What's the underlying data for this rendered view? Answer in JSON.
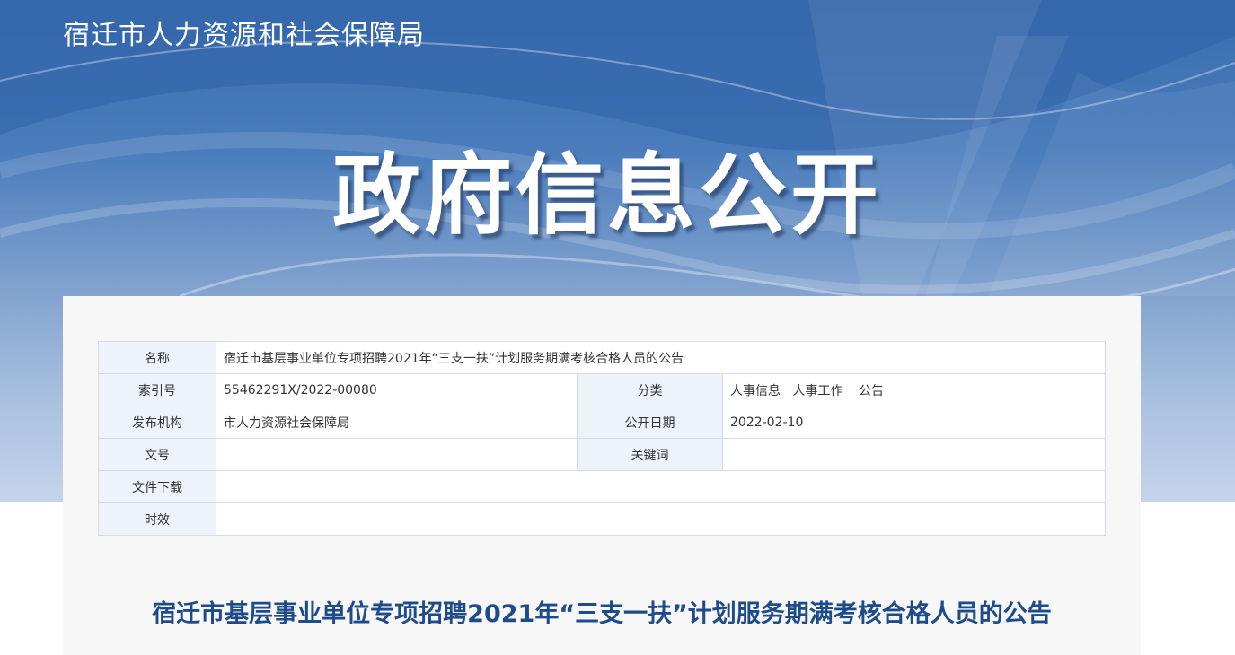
{
  "header": {
    "site_title": "宿迁市人力资源和社会保障局",
    "hero_title": "政府信息公开"
  },
  "meta_table": {
    "name_label": "名称",
    "name_value": "宿迁市基层事业单位专项招聘2021年“三支一扶”计划服务期满考核合格人员的公告",
    "index_label": "索引号",
    "index_value": "55462291X/2022-00080",
    "category_label": "分类",
    "category_value": "人事信息   人事工作    公告",
    "publisher_label": "发布机构",
    "publisher_value": "市人力资源社会保障局",
    "date_label": "公开日期",
    "date_value": "2022-02-10",
    "doc_no_label": "文号",
    "doc_no_value": "",
    "keywords_label": "关键词",
    "keywords_value": "",
    "download_label": "文件下载",
    "download_value": "",
    "validity_label": "时效",
    "validity_value": ""
  },
  "article": {
    "title": "宿迁市基层事业单位专项招聘2021年“三支一扶”计划服务期满考核合格人员的公告"
  },
  "colors": {
    "banner_top": "#3a6db0",
    "banner_bottom": "#c4d4ea",
    "title_blue": "#1e4c8b",
    "label_bg": "#eef2fa",
    "border": "#d5dbe6"
  }
}
